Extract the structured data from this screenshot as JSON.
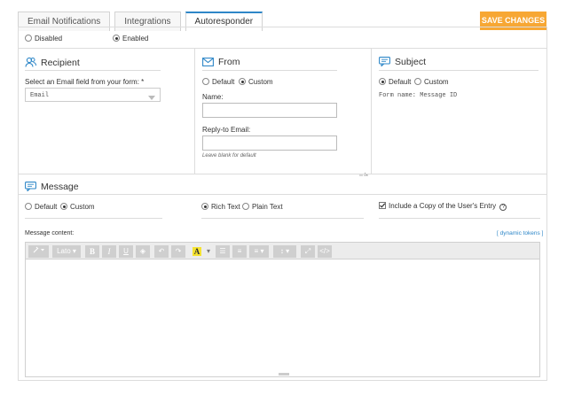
{
  "tabs": [
    {
      "label": "Email Notifications"
    },
    {
      "label": "Integrations"
    },
    {
      "label": "Autoresponder"
    }
  ],
  "save_label": "SAVE CHANGES",
  "status": {
    "disabled": "Disabled",
    "enabled": "Enabled"
  },
  "recipient": {
    "title": "Recipient",
    "field_label": "Select an Email field from your form: *",
    "field_value": "Email"
  },
  "from": {
    "title": "From",
    "opt_default": "Default",
    "opt_custom": "Custom",
    "name_label": "Name:",
    "reply_label": "Reply-to Email:",
    "reply_hint": "Leave blank for default"
  },
  "subject": {
    "title": "Subject",
    "opt_default": "Default",
    "opt_custom": "Custom",
    "value": "Form name: Message ID"
  },
  "message": {
    "title": "Message",
    "opt_default": "Default",
    "opt_custom": "Custom",
    "rich_text": "Rich Text",
    "plain_text": "Plain Text",
    "include_copy": "Include a Copy of the User's Entry",
    "content_label": "Message content:",
    "dynamic_tokens": "[ dynamic tokens ]"
  },
  "toolbar": {
    "font": "Lato"
  },
  "colors": {
    "accent": "#2e87c8",
    "save": "#f7a734"
  }
}
